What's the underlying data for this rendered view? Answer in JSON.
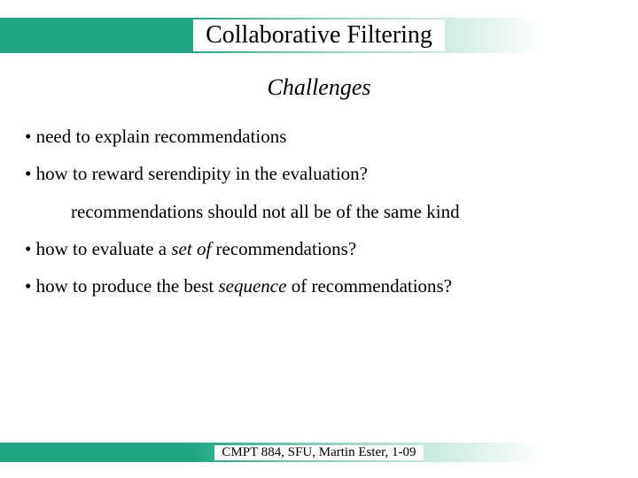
{
  "title": "Collaborative Filtering",
  "subtitle": "Challenges",
  "bullets": {
    "b1": "• need to explain recommendations",
    "b2": "• how to reward serendipity in the evaluation?",
    "b2_sub": "recommendations should not all be of the same kind",
    "b3_pre": "• how to evaluate a ",
    "b3_em": "set of",
    "b3_post": " recommendations?",
    "b4_pre": "• how to produce the best ",
    "b4_em": "sequence",
    "b4_post": " of recommendations?"
  },
  "footer": "CMPT 884, SFU, Martin Ester, 1-09"
}
